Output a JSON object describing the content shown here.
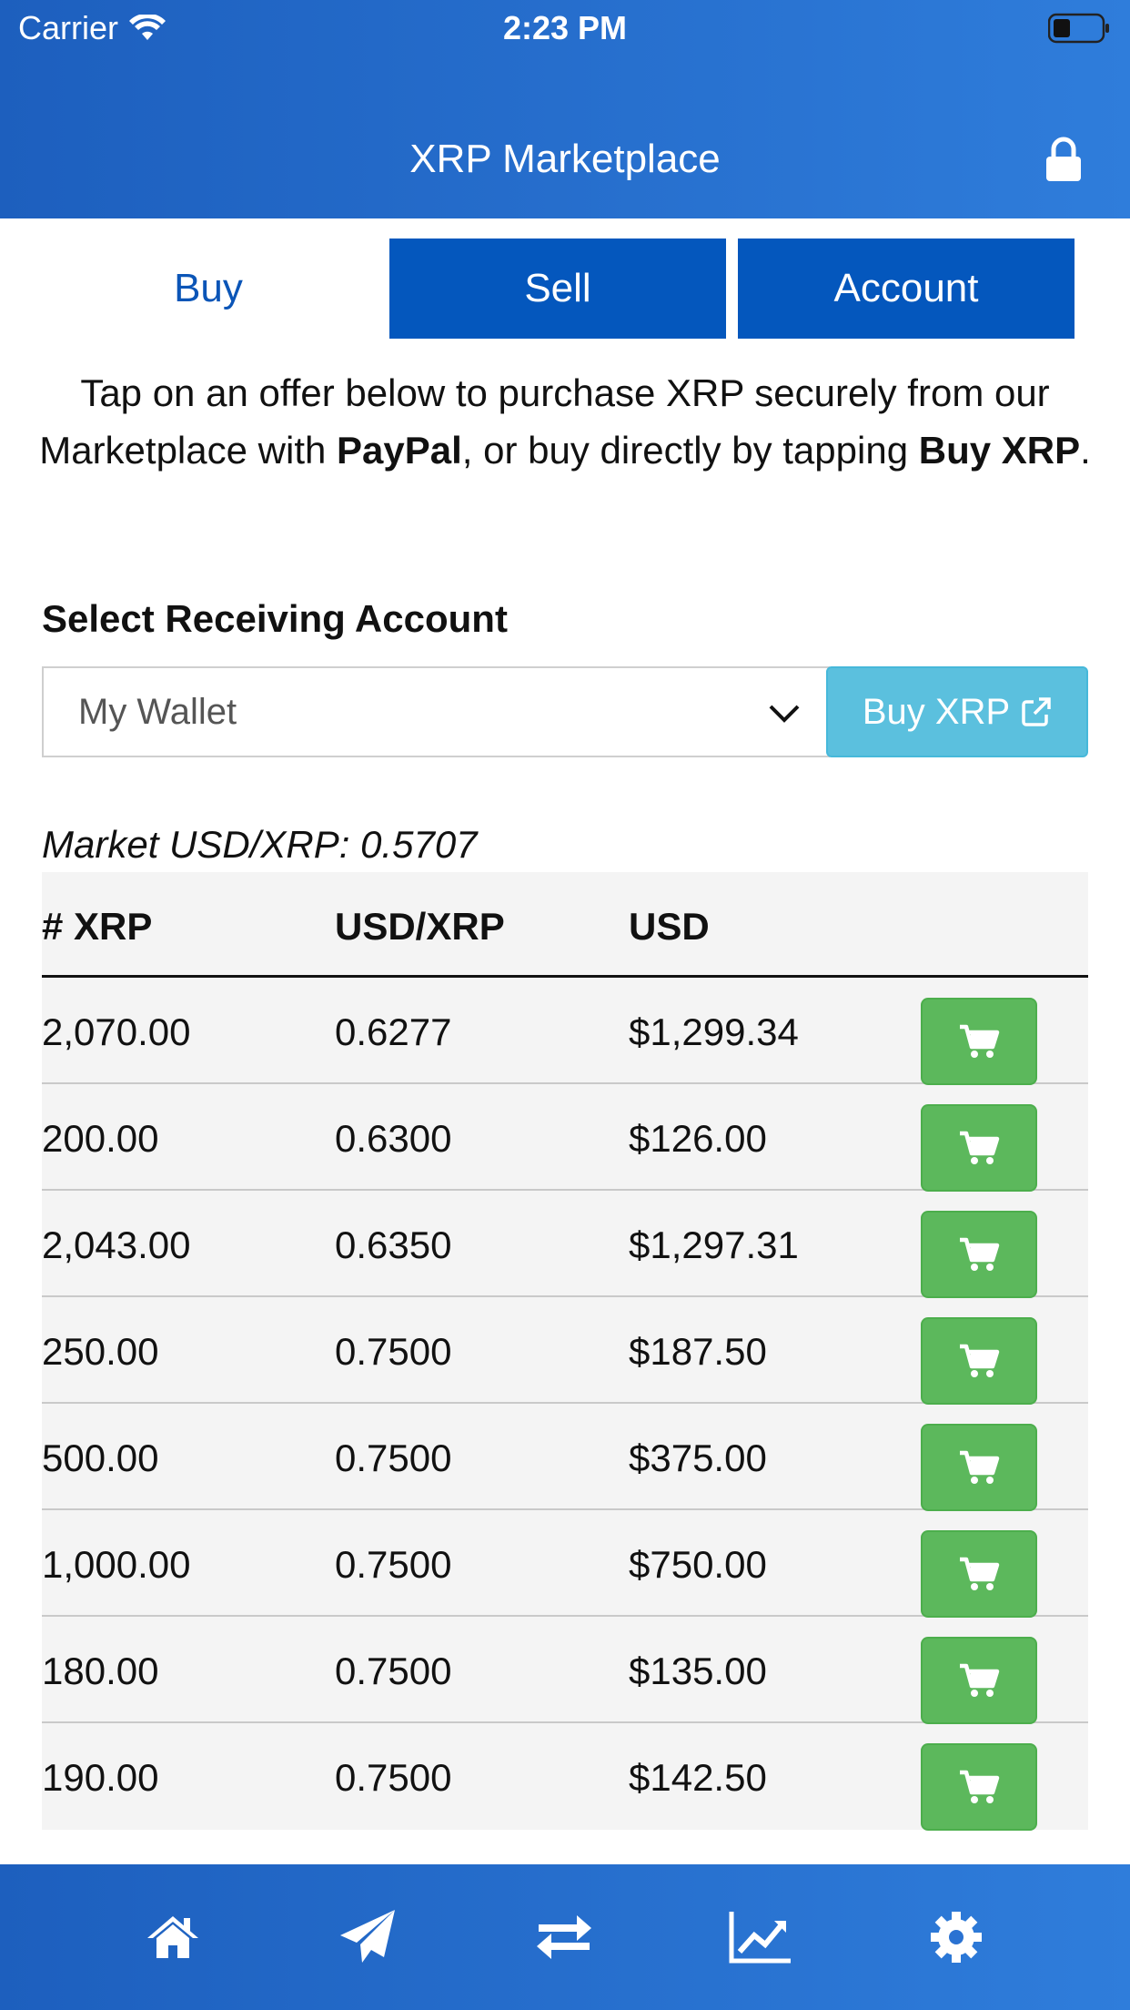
{
  "status_bar": {
    "carrier": "Carrier",
    "time": "2:23 PM"
  },
  "header": {
    "title": "XRP Marketplace",
    "lock_icon": "lock-icon"
  },
  "tabs": [
    {
      "label": "Buy",
      "active": true
    },
    {
      "label": "Sell",
      "active": false
    },
    {
      "label": "Account",
      "active": false
    }
  ],
  "intro": {
    "part1": "Tap on an offer below to purchase XRP securely from our Marketplace with ",
    "paypal": "PayPal",
    "part2": ", or buy directly by tapping ",
    "buy_xrp": "Buy XRP",
    "part3": "."
  },
  "receiving": {
    "label": "Select Receiving Account",
    "selected": "My Wallet",
    "buy_button": "Buy XRP"
  },
  "market": {
    "text": "Market USD/XRP: 0.5707"
  },
  "table": {
    "headers": [
      "# XRP",
      "USD/XRP",
      "USD"
    ],
    "rows": [
      {
        "xrp": "2,070.00",
        "rate": "0.6277",
        "usd": "$1,299.34"
      },
      {
        "xrp": "200.00",
        "rate": "0.6300",
        "usd": "$126.00"
      },
      {
        "xrp": "2,043.00",
        "rate": "0.6350",
        "usd": "$1,297.31"
      },
      {
        "xrp": "250.00",
        "rate": "0.7500",
        "usd": "$187.50"
      },
      {
        "xrp": "500.00",
        "rate": "0.7500",
        "usd": "$375.00"
      },
      {
        "xrp": "1,000.00",
        "rate": "0.7500",
        "usd": "$750.00"
      },
      {
        "xrp": "180.00",
        "rate": "0.7500",
        "usd": "$135.00"
      },
      {
        "xrp": "190.00",
        "rate": "0.7500",
        "usd": "$142.50"
      }
    ]
  },
  "bottom_nav": [
    "home-icon",
    "send-icon",
    "exchange-icon",
    "chart-icon",
    "gear-icon"
  ],
  "colors": {
    "header": "#1d5fbe",
    "tab": "#0457bd",
    "buy_button": "#5bc0de",
    "cart": "#5cb85c"
  }
}
